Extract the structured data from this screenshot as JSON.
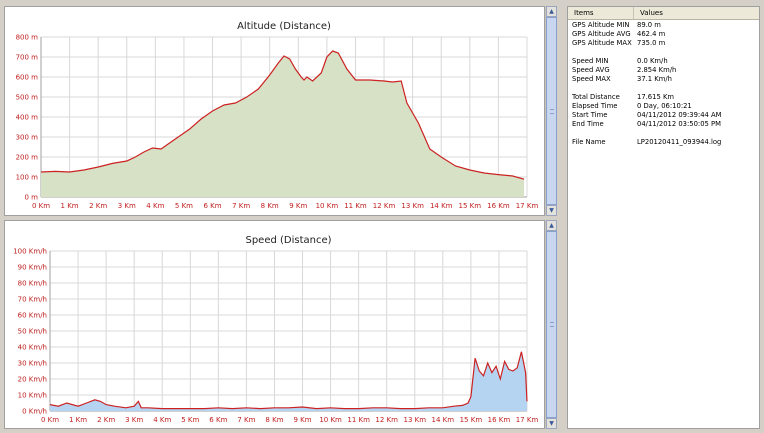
{
  "colors": {
    "curve": "#cc2222",
    "altitude_fill": "#d6e1c6",
    "speed_fill": "#b4d4f2",
    "tick_text": "#c02020"
  },
  "scrollbar_icons": [
    "arrow-up-icon",
    "arrow-down-icon",
    "grip-icon"
  ],
  "table": {
    "headers": {
      "items": "Items",
      "values": "Values"
    },
    "rows": [
      {
        "item": "GPS Altitude MIN",
        "value": "89.0 m"
      },
      {
        "item": "GPS Altitude AVG",
        "value": "462.4 m"
      },
      {
        "item": "GPS Altitude MAX",
        "value": "735.0 m"
      },
      {
        "item": "",
        "value": ""
      },
      {
        "item": "Speed MIN",
        "value": "0.0 Km/h"
      },
      {
        "item": "Speed AVG",
        "value": "2.854 Km/h"
      },
      {
        "item": "Speed MAX",
        "value": "37.1 Km/h"
      },
      {
        "item": "",
        "value": ""
      },
      {
        "item": "Total Distance",
        "value": "17.615 Km"
      },
      {
        "item": "Elapsed Time",
        "value": "0 Day, 06:10:21"
      },
      {
        "item": "Start Time",
        "value": "04/11/2012 09:39:44 AM"
      },
      {
        "item": "End Time",
        "value": "04/11/2012 03:50:05 PM"
      },
      {
        "item": "",
        "value": ""
      },
      {
        "item": "File Name",
        "value": "LP20120411_093944.log"
      }
    ]
  },
  "chart_data": [
    {
      "type": "area",
      "title": "Altitude (Distance)",
      "xlabel": "",
      "ylabel": "",
      "xlim": [
        0,
        17
      ],
      "ylim": [
        0,
        800
      ],
      "x_ticks": [
        "0 Km",
        "1 Km",
        "2 Km",
        "3 Km",
        "4 Km",
        "5 Km",
        "6 Km",
        "7 Km",
        "8 Km",
        "9 Km",
        "10 Km",
        "11 Km",
        "12 Km",
        "13 Km",
        "14 Km",
        "15 Km",
        "16 Km",
        "17 Km"
      ],
      "y_ticks": [
        "0 m",
        "100 m",
        "200 m",
        "300 m",
        "400 m",
        "500 m",
        "600 m",
        "700 m",
        "800 m"
      ],
      "grid": true,
      "x": [
        0,
        0.5,
        1,
        1.5,
        2,
        2.5,
        3,
        3.3,
        3.6,
        3.9,
        4.2,
        4.5,
        4.8,
        5.2,
        5.6,
        6,
        6.4,
        6.8,
        7.2,
        7.6,
        8,
        8.3,
        8.5,
        8.7,
        8.9,
        9.1,
        9.2,
        9.3,
        9.5,
        9.8,
        10,
        10.2,
        10.4,
        10.7,
        11,
        11.5,
        12,
        12.3,
        12.6,
        12.8,
        13.2,
        13.6,
        14,
        14.5,
        15,
        15.5,
        16,
        16.5,
        16.9
      ],
      "y": [
        125,
        128,
        125,
        135,
        150,
        168,
        180,
        200,
        225,
        245,
        240,
        270,
        300,
        340,
        390,
        430,
        460,
        470,
        500,
        540,
        610,
        670,
        705,
        690,
        640,
        600,
        585,
        600,
        580,
        620,
        700,
        730,
        720,
        640,
        585,
        585,
        580,
        575,
        580,
        470,
        370,
        240,
        200,
        155,
        135,
        120,
        112,
        105,
        89
      ]
    },
    {
      "type": "area",
      "title": "Speed (Distance)",
      "xlabel": "",
      "ylabel": "",
      "xlim": [
        0,
        17
      ],
      "ylim": [
        0,
        100
      ],
      "x_ticks": [
        "0 Km",
        "1 Km",
        "2 Km",
        "3 Km",
        "4 Km",
        "5 Km",
        "6 Km",
        "7 Km",
        "8 Km",
        "9 Km",
        "10 Km",
        "11 Km",
        "12 Km",
        "13 Km",
        "14 Km",
        "15 Km",
        "16 Km",
        "17 Km"
      ],
      "y_ticks": [
        "0 Km/h",
        "10 Km/h",
        "20 Km/h",
        "30 Km/h",
        "40 Km/h",
        "50 Km/h",
        "60 Km/h",
        "70 Km/h",
        "80 Km/h",
        "90 Km/h",
        "100 Km/h"
      ],
      "grid": true,
      "x": [
        0,
        0.3,
        0.6,
        1,
        1.3,
        1.6,
        1.8,
        2,
        2.3,
        2.7,
        3,
        3.15,
        3.25,
        3.5,
        4,
        4.5,
        5,
        5.5,
        6,
        6.5,
        7,
        7.5,
        8,
        8.5,
        9,
        9.5,
        10,
        10.5,
        11,
        11.5,
        12,
        12.5,
        13,
        13.5,
        14,
        14.4,
        14.7,
        14.9,
        15,
        15.15,
        15.3,
        15.45,
        15.6,
        15.75,
        15.9,
        16.05,
        16.2,
        16.35,
        16.5,
        16.65,
        16.8,
        16.95,
        17
      ],
      "y": [
        4,
        3,
        5,
        3,
        5,
        7,
        6,
        4,
        3,
        2,
        3,
        6,
        2,
        2,
        1.5,
        1.5,
        1.5,
        1.5,
        2,
        1.5,
        2,
        1.5,
        2,
        2,
        2.5,
        1.5,
        2,
        1.5,
        1.5,
        2,
        2,
        1.5,
        1.5,
        2,
        2,
        3,
        3.5,
        5,
        9,
        33,
        25,
        22,
        30,
        24,
        28,
        20,
        31,
        26,
        25,
        27,
        37,
        24,
        6
      ]
    }
  ]
}
